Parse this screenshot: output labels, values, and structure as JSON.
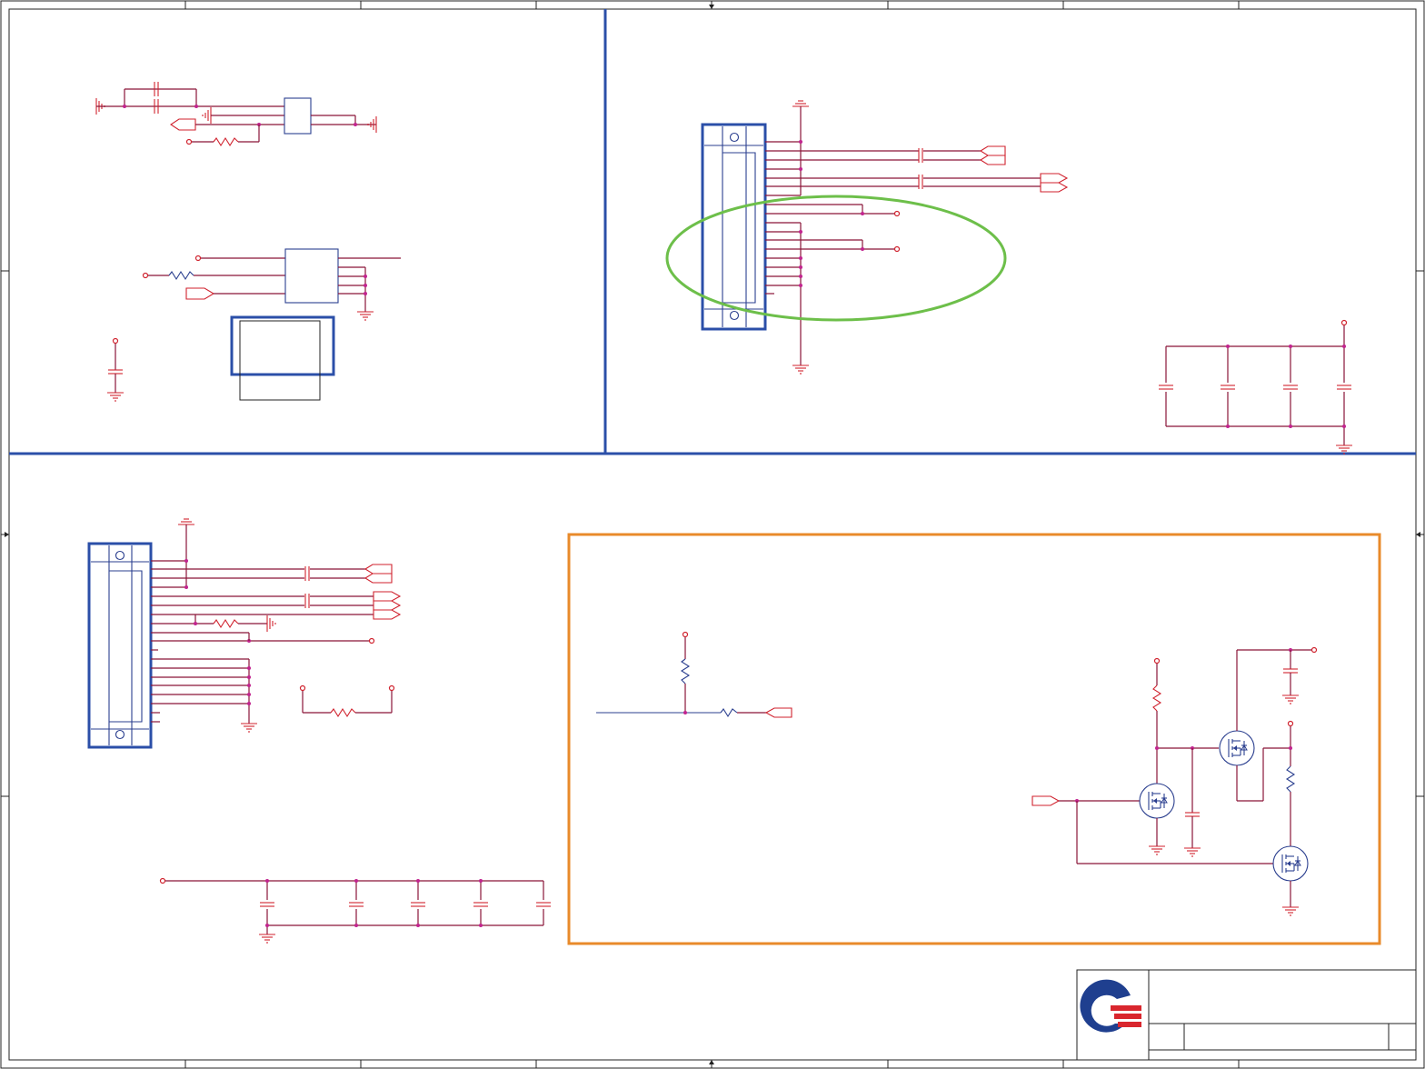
{
  "sheet": {
    "title": "",
    "colors": {
      "wire": "#8a1538",
      "net_port": "#d0222e",
      "component": "#2b3f8f",
      "junction": "#c2248f",
      "highlight_green": "#6dbf4a",
      "highlight_orange": "#e88a2a",
      "section_border": "#2b4fa8"
    }
  },
  "sections": {
    "top_left": {
      "name": "top-left-oscillator-block"
    },
    "top_right": {
      "name": "top-right-connector-block"
    },
    "bottom_left": {
      "name": "bottom-left-connector-block"
    },
    "bottom_right": {
      "name": "bottom-right-mosfet-switch-block"
    }
  },
  "title_block": {
    "logo": "company-logo",
    "title": "",
    "size": "",
    "document_number": "",
    "rev": ""
  }
}
